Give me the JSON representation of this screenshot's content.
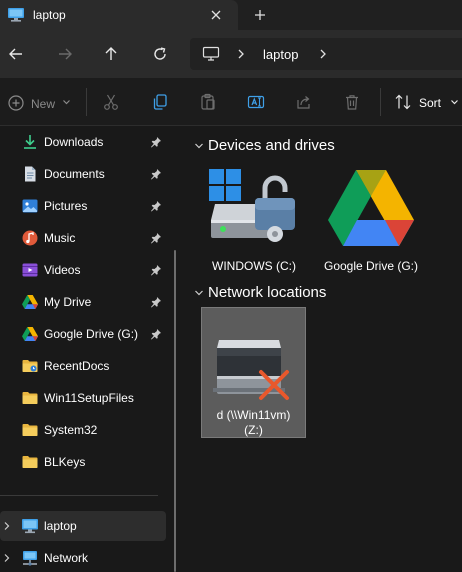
{
  "tab": {
    "title": "laptop",
    "icon": "computer-icon"
  },
  "navigation": {
    "back_icon": "back-arrow-icon",
    "forward_icon": "forward-arrow-icon",
    "up_icon": "up-arrow-icon",
    "refresh_icon": "refresh-icon",
    "address": {
      "location": "laptop",
      "icon": "computer-icon"
    }
  },
  "commandbar": {
    "new_label": "New",
    "actions": [
      "cut-icon",
      "copy-icon",
      "paste-icon",
      "rename-icon",
      "share-icon",
      "delete-icon"
    ],
    "sort_label": "Sort"
  },
  "sidebar": {
    "quick_access": [
      {
        "label": "Downloads",
        "icon": "download-icon",
        "pinned": true
      },
      {
        "label": "Documents",
        "icon": "documents-icon",
        "pinned": true
      },
      {
        "label": "Pictures",
        "icon": "pictures-icon",
        "pinned": true
      },
      {
        "label": "Music",
        "icon": "music-icon",
        "pinned": true
      },
      {
        "label": "Videos",
        "icon": "videos-icon",
        "pinned": true
      },
      {
        "label": "My Drive",
        "icon": "google-drive-icon",
        "pinned": true
      },
      {
        "label": "Google Drive (G:)",
        "icon": "google-drive-icon",
        "pinned": true
      },
      {
        "label": "RecentDocs",
        "icon": "folder-icon",
        "pinned": false
      },
      {
        "label": "Win11SetupFiles",
        "icon": "folder-icon",
        "pinned": false
      },
      {
        "label": "System32",
        "icon": "folder-icon",
        "pinned": false
      },
      {
        "label": "BLKeys",
        "icon": "folder-icon",
        "pinned": false
      }
    ],
    "locations": [
      {
        "label": "laptop",
        "icon": "computer-icon",
        "selected": true
      },
      {
        "label": "Network",
        "icon": "network-icon",
        "selected": false
      }
    ]
  },
  "main": {
    "devices_heading": "Devices and drives",
    "devices": [
      {
        "label": "WINDOWS (C:)",
        "icon": "bitlocker-drive-icon"
      },
      {
        "label": "Google Drive (G:)",
        "icon": "google-drive-icon"
      }
    ],
    "network_heading": "Network locations",
    "network": [
      {
        "label_line1": "d (\\\\Win11vm)",
        "label_line2": "(Z:)",
        "icon": "disconnected-network-drive-icon"
      }
    ]
  },
  "colors": {
    "window_bg": "#191919",
    "titlebar_bg": "#202020",
    "navbar_bg": "#2b2b2b",
    "accent_blue": "#0078d4",
    "folder_yellow": "#e8b53f",
    "selection_bg": "#5c5c5c"
  }
}
